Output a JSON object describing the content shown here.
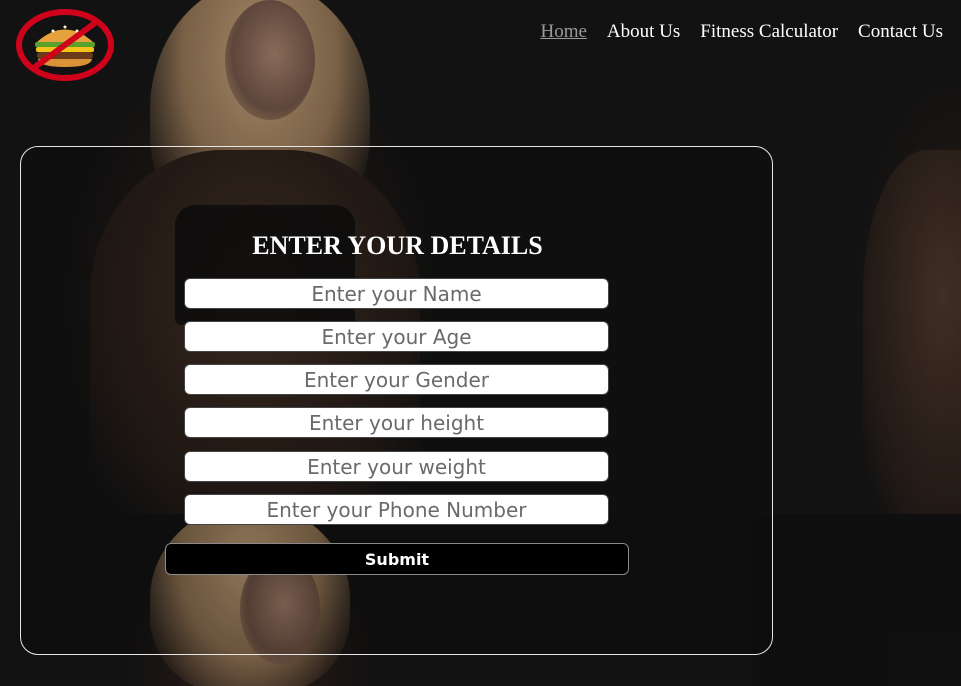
{
  "header": {
    "logo_icon": "no-burger-icon",
    "nav": [
      {
        "label": "Home",
        "active": true
      },
      {
        "label": "About Us",
        "active": false
      },
      {
        "label": "Fitness Calculator",
        "active": false
      },
      {
        "label": "Contact Us",
        "active": false
      }
    ]
  },
  "form": {
    "title": "ENTER YOUR DETAILS",
    "fields": [
      {
        "name": "name",
        "placeholder": "Enter your Name"
      },
      {
        "name": "age",
        "placeholder": "Enter your Age"
      },
      {
        "name": "gender",
        "placeholder": "Enter your Gender"
      },
      {
        "name": "height",
        "placeholder": "Enter your height"
      },
      {
        "name": "weight",
        "placeholder": "Enter your weight"
      },
      {
        "name": "phone",
        "placeholder": "Enter your Phone Number"
      }
    ],
    "submit_label": "Submit"
  },
  "colors": {
    "accent_red": "#d0021b",
    "card_border": "#e6e6e6",
    "nav_active": "#9a9a9a"
  }
}
